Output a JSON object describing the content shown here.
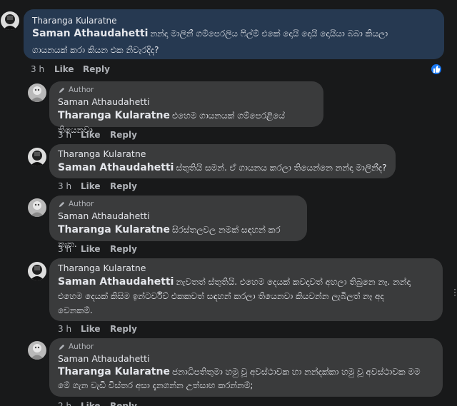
{
  "labels": {
    "like": "Like",
    "reply": "Reply",
    "author": "Author"
  },
  "comments": [
    {
      "name": "Tharanga Kularatne",
      "tag": "Saman Athaudahetti",
      "lines": [
        "නන්දා මාලිනී ගම්පෙරලිය ෆිල්ම් එකේ දොයි දොයි දොයියා බබා කියලා",
        "ගායනයක් කරා කියන එක නිවැරදිද?"
      ],
      "time": "3 h"
    },
    {
      "name": "Saman Athaudahetti",
      "tag": "Tharanga Kularatne",
      "lines": [
        "එහෙම ගායනයක් ගම්පෙරළියේ තියෙනවා"
      ],
      "time": "3 h"
    },
    {
      "name": "Tharanga Kularatne",
      "tag": "Saman Athaudahetti",
      "lines": [
        "ස්තුතියි සමන්. ඒ ගායනය කරලා තියෙන්නෙ නන්දා මාලිනීද?"
      ],
      "time": "3 h"
    },
    {
      "name": "Saman Athaudahetti",
      "tag": "Tharanga Kularatne",
      "lines": [
        "සිරස්තලවල නමක් සඳහන් කර නැත."
      ],
      "time": "3 h"
    },
    {
      "name": "Tharanga Kularatne",
      "tag": "Saman Athaudahetti",
      "lines": [
        "නැවතත් ස්තුතියි. එහෙම දෙයක් කවදාවත් අහලා තිබුනෙ නෑ. නන්දා",
        "එහෙම දෙයක් කිසිම ඉන්ටර්විව් එකකවත් සඳහන් කරලා තියෙනවා කියවන්න ලැබිලත් නෑ අද",
        "වෙනකම්."
      ],
      "time": "3 h"
    },
    {
      "name": "Saman Athaudahetti",
      "tag": "Tharanga Kularatne",
      "lines": [
        "ජනාධිපතිතුමා හමු වූ අවස්ථාවක හා නන්දක්කා හමු වූ අවස්ථාවක මම",
        "මේ ගැන වැඩි විස්තර අසා දැනගන්න උත්සාහ කරන්නම්;"
      ],
      "time": "2 h"
    }
  ]
}
